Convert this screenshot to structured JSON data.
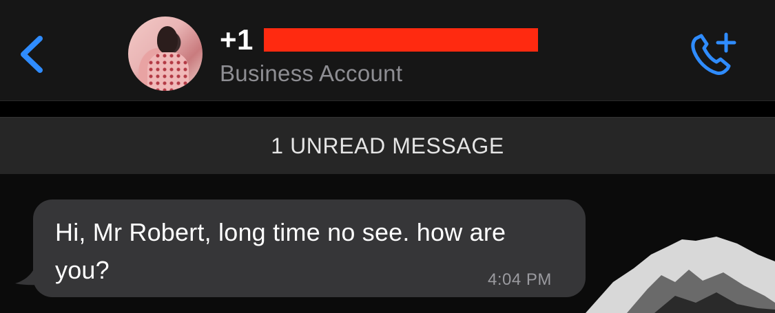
{
  "header": {
    "contact_number": "+1",
    "account_type": "Business Account"
  },
  "banner": {
    "unread_label": "1 UNREAD MESSAGE"
  },
  "messages": [
    {
      "text": "Hi, Mr Robert, long time no see. how are you?",
      "time": "4:04 PM",
      "direction": "incoming"
    }
  ],
  "icons": {
    "back": "chevron-left-icon",
    "call": "phone-plus-icon"
  },
  "colors": {
    "accent": "#2f8cff",
    "redaction": "#ff2a10",
    "bubble": "#363638"
  }
}
